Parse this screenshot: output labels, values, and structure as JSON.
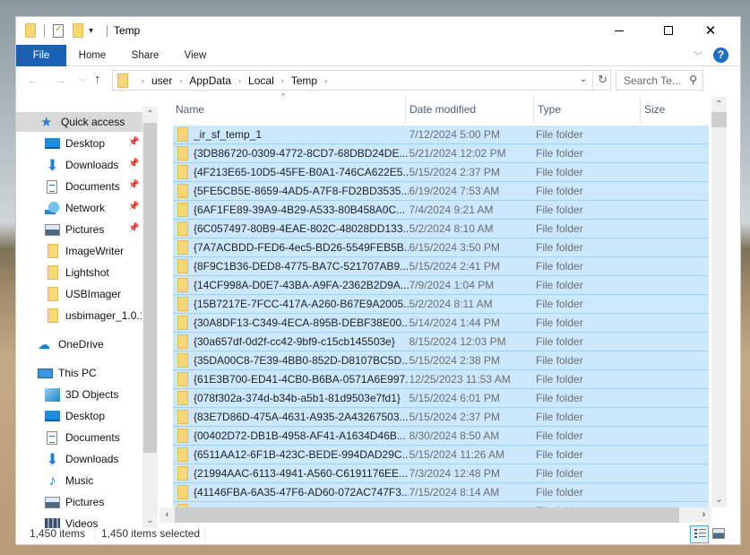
{
  "window": {
    "title": "Temp",
    "controls": {
      "minimize": "minimize",
      "maximize": "maximize",
      "close": "close"
    }
  },
  "ribbon": {
    "tabs": [
      {
        "label": "File",
        "active": true
      },
      {
        "label": "Home"
      },
      {
        "label": "Share"
      },
      {
        "label": "View"
      }
    ],
    "help_label": "?"
  },
  "address": {
    "breadcrumbs": [
      "user",
      "AppData",
      "Local",
      "Temp"
    ]
  },
  "search": {
    "placeholder": "Search Te..."
  },
  "nav_pane": {
    "items": [
      {
        "label": "Quick access",
        "icon": "quick-access-star-icon",
        "selected": true
      },
      {
        "label": "Desktop",
        "icon": "desktop-icon",
        "pinned": true
      },
      {
        "label": "Downloads",
        "icon": "downloads-icon",
        "pinned": true
      },
      {
        "label": "Documents",
        "icon": "documents-icon",
        "pinned": true
      },
      {
        "label": "Network",
        "icon": "network-icon",
        "pinned": true
      },
      {
        "label": "Pictures",
        "icon": "pictures-icon",
        "pinned": true
      },
      {
        "label": "ImageWriter",
        "icon": "folder-icon"
      },
      {
        "label": "Lightshot",
        "icon": "folder-icon"
      },
      {
        "label": "USBImager",
        "icon": "folder-icon"
      },
      {
        "label": "usbimager_1.0.1",
        "icon": "folder-icon"
      },
      {
        "label": "OneDrive",
        "icon": "onedrive-cloud-icon"
      },
      {
        "label": "This PC",
        "icon": "this-pc-icon"
      },
      {
        "label": "3D Objects",
        "icon": "3d-objects-icon"
      },
      {
        "label": "Desktop",
        "icon": "desktop-icon"
      },
      {
        "label": "Documents",
        "icon": "documents-icon"
      },
      {
        "label": "Downloads",
        "icon": "downloads-icon"
      },
      {
        "label": "Music",
        "icon": "music-icon"
      },
      {
        "label": "Pictures",
        "icon": "pictures-icon"
      },
      {
        "label": "Videos",
        "icon": "videos-icon"
      }
    ]
  },
  "file_list": {
    "columns": {
      "name": "Name",
      "date": "Date modified",
      "type": "Type",
      "size": "Size"
    },
    "rows": [
      {
        "name": "_ir_sf_temp_1",
        "date": "7/12/2024 5:00 PM",
        "type": "File folder",
        "size": ""
      },
      {
        "name": "{3DB86720-0309-4772-8CD7-68DBD24DE...",
        "date": "5/21/2024 12:02 PM",
        "type": "File folder",
        "size": ""
      },
      {
        "name": "{4F213E65-10D5-45FE-B0A1-746CA622E5...",
        "date": "5/15/2024 2:37 PM",
        "type": "File folder",
        "size": ""
      },
      {
        "name": "{5FE5CB5E-8659-4AD5-A7F8-FD2BD3535...",
        "date": "6/19/2024 7:53 AM",
        "type": "File folder",
        "size": ""
      },
      {
        "name": "{6AF1FE89-39A9-4B29-A533-80B458A0C...",
        "date": "7/4/2024 9:21 AM",
        "type": "File folder",
        "size": ""
      },
      {
        "name": "{6C057497-80B9-4EAE-802C-48028DD133...",
        "date": "5/2/2024 8:10 AM",
        "type": "File folder",
        "size": ""
      },
      {
        "name": "{7A7ACBDD-FED6-4ec5-BD26-5549FEB5B...",
        "date": "6/15/2024 3:50 PM",
        "type": "File folder",
        "size": ""
      },
      {
        "name": "{8F9C1B36-DED8-4775-BA7C-521707AB9...",
        "date": "5/15/2024 2:41 PM",
        "type": "File folder",
        "size": ""
      },
      {
        "name": "{14CF998A-D0E7-43BA-A9FA-2362B2D9A...",
        "date": "7/9/2024 1:04 PM",
        "type": "File folder",
        "size": ""
      },
      {
        "name": "{15B7217E-7FCC-417A-A260-B67E9A2005...",
        "date": "5/2/2024 8:11 AM",
        "type": "File folder",
        "size": ""
      },
      {
        "name": "{30A8DF13-C349-4ECA-895B-DEBF38E00...",
        "date": "5/14/2024 1:44 PM",
        "type": "File folder",
        "size": ""
      },
      {
        "name": "{30a657df-0d2f-cc42-9bf9-c15cb145503e}",
        "date": "8/15/2024 12:03 PM",
        "type": "File folder",
        "size": ""
      },
      {
        "name": "{35DA00C8-7E39-4BB0-852D-D8107BC5D...",
        "date": "5/15/2024 2:38 PM",
        "type": "File folder",
        "size": ""
      },
      {
        "name": "{61E3B700-ED41-4CB0-B6BA-0571A6E997...",
        "date": "12/25/2023 11:53 AM",
        "type": "File folder",
        "size": ""
      },
      {
        "name": "{078f302a-374d-b34b-a5b1-81d9503e7fd1}",
        "date": "5/15/2024 6:01 PM",
        "type": "File folder",
        "size": ""
      },
      {
        "name": "{83E7D86D-475A-4631-A935-2A43267503...",
        "date": "5/15/2024 2:37 PM",
        "type": "File folder",
        "size": ""
      },
      {
        "name": "{00402D72-DB1B-4958-AF41-A1634D46B...",
        "date": "8/30/2024 8:50 AM",
        "type": "File folder",
        "size": ""
      },
      {
        "name": "{6511AA12-6F1B-423C-BEDE-994DAD29C...",
        "date": "5/15/2024 11:26 AM",
        "type": "File folder",
        "size": ""
      },
      {
        "name": "{21994AAC-6113-4941-A560-C6191176EE...",
        "date": "7/3/2024 12:48 PM",
        "type": "File folder",
        "size": ""
      },
      {
        "name": "{41146FBA-6A35-47F6-AD60-072AC747F3...",
        "date": "7/15/2024 8:14 AM",
        "type": "File folder",
        "size": ""
      },
      {
        "name": "",
        "date": "",
        "type": "File folder",
        "size": ""
      }
    ],
    "all_selected": true
  },
  "status_bar": {
    "item_count": "1,450 items",
    "selected_count": "1,450 items selected"
  },
  "colors": {
    "accent": "#1a61b5",
    "selection_bg": "#cce8ff",
    "selection_border": "#99d1ff",
    "folder": "#f8d775"
  }
}
